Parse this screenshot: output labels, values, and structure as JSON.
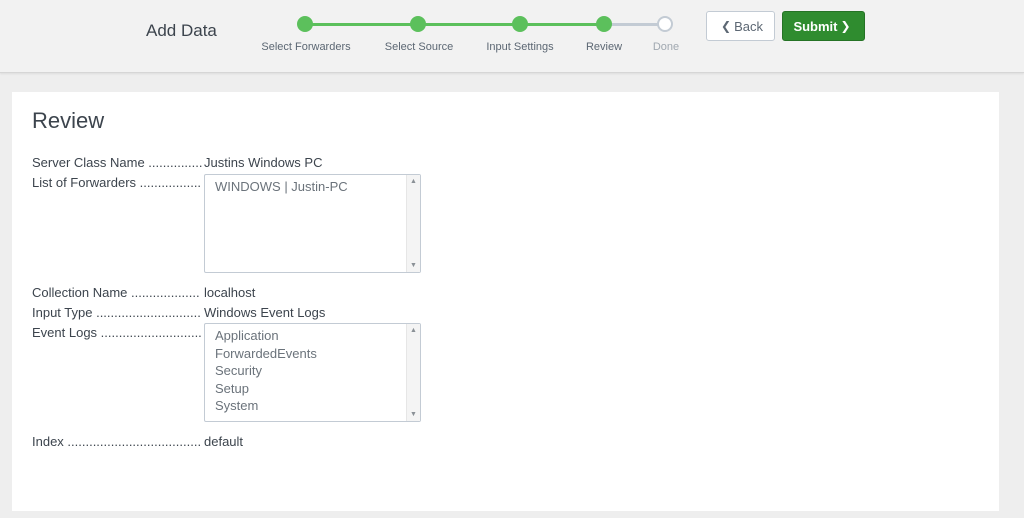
{
  "header": {
    "title": "Add Data",
    "steps": [
      {
        "label": "Select Forwarders",
        "state": "done"
      },
      {
        "label": "Select Source",
        "state": "done"
      },
      {
        "label": "Input Settings",
        "state": "done"
      },
      {
        "label": "Review",
        "state": "current"
      },
      {
        "label": "Done",
        "state": "pending"
      }
    ],
    "back_label": "Back",
    "submit_label": "Submit",
    "colors": {
      "step_complete": "#5cc05c",
      "step_pending": "#c3cbd4",
      "submit_bg": "#2f8c2f"
    }
  },
  "review": {
    "title": "Review",
    "server_class_name": {
      "label": "Server Class Name ...............",
      "value": "Justins Windows PC"
    },
    "list_of_forwarders": {
      "label": "List of Forwarders .................",
      "items": [
        "WINDOWS | Justin-PC"
      ]
    },
    "collection_name": {
      "label": "Collection Name ...................",
      "value": "localhost"
    },
    "input_type": {
      "label": "Input Type ................................",
      "value": "Windows Event Logs"
    },
    "event_logs": {
      "label": "Event Logs ...............................",
      "items": [
        "Application",
        "ForwardedEvents",
        "Security",
        "Setup",
        "System"
      ]
    },
    "index": {
      "label": "Index ..........................................",
      "value": "default"
    }
  }
}
